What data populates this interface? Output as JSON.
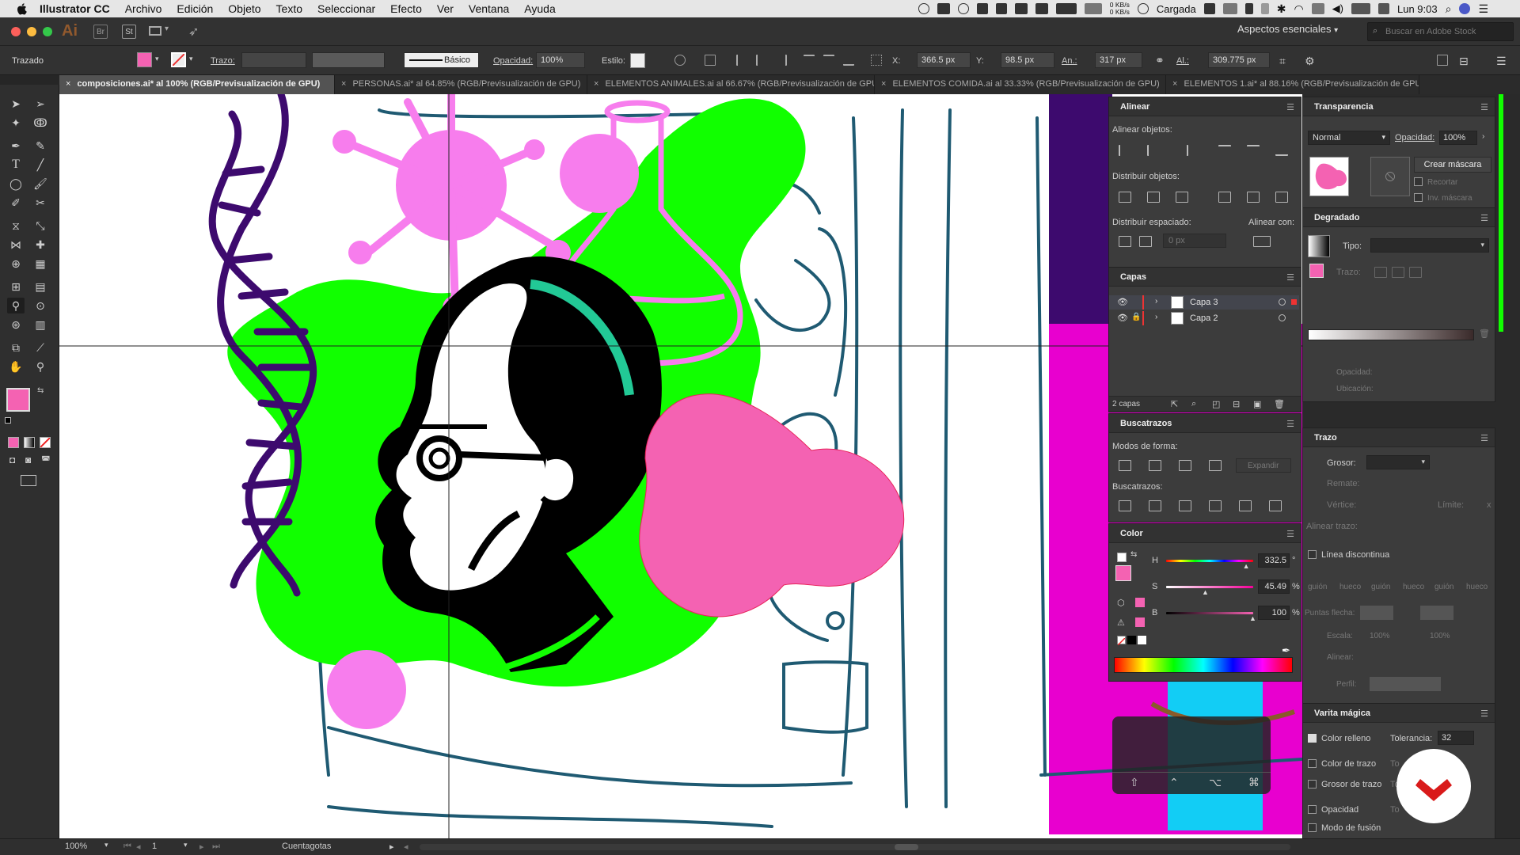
{
  "menubar": {
    "apple": "",
    "app": "Illustrator CC",
    "items": [
      "Archivo",
      "Edición",
      "Objeto",
      "Texto",
      "Seleccionar",
      "Efecto",
      "Ver",
      "Ventana",
      "Ayuda"
    ],
    "net_up": "0 KB/s",
    "net_down": "0 KB/s",
    "battery": "Cargada",
    "clock": "Lun 9:03"
  },
  "appbar": {
    "logo": "Ai",
    "br": "Br",
    "st": "St",
    "workspace": "Aspectos esenciales",
    "search_placeholder": "Buscar en Adobe Stock"
  },
  "control": {
    "selection": "Trazado",
    "stroke_label": "Trazo:",
    "brush": "Básico",
    "opacity_label": "Opacidad:",
    "opacity": "100%",
    "style_label": "Estilo:",
    "x_label": "X:",
    "x": "366.5 px",
    "y_label": "Y:",
    "y": "98.5 px",
    "w_label": "An.:",
    "w": "317 px",
    "h_label": "Al.:",
    "h": "309.775 px"
  },
  "tabs": [
    {
      "label": "composiciones.ai* al 100% (RGB/Previsualización de GPU)"
    },
    {
      "label": "PERSONAS.ai* al 64.85% (RGB/Previsualización de GPU)"
    },
    {
      "label": "ELEMENTOS ANIMALES.ai al 66.67% (RGB/Previsualización de GPU)"
    },
    {
      "label": "ELEMENTOS COMIDA.ai al 33.33% (RGB/Previsualización de GPU)"
    },
    {
      "label": "ELEMENTOS 1.ai* al 88.16% (RGB/Previsualización de GPU)"
    }
  ],
  "align": {
    "title": "Alinear",
    "align_objects": "Alinear objetos:",
    "distribute_objects": "Distribuir objetos:",
    "distribute_spacing": "Distribuir espaciado:",
    "align_to": "Alinear con:",
    "spacing": "0 px"
  },
  "layers": {
    "title": "Capas",
    "rows": [
      {
        "name": "Capa 3"
      },
      {
        "name": "Capa 2"
      }
    ],
    "count": "2 capas"
  },
  "pathfinder": {
    "title": "Buscatrazos",
    "shape_modes": "Modos de forma:",
    "expand": "Expandir",
    "pathfinders": "Buscatrazos:"
  },
  "color": {
    "title": "Color",
    "h_label": "H",
    "h": "332.5",
    "h_unit": "°",
    "s_label": "S",
    "s": "45.49",
    "s_unit": "%",
    "b_label": "B",
    "b": "100",
    "b_unit": "%",
    "fill_hex": "#f462b2",
    "h_fraction": 0.924,
    "s_fraction": 0.455,
    "b_fraction": 1.0
  },
  "transparency": {
    "title": "Transparencia",
    "blend": "Normal",
    "opacity_label": "Opacidad:",
    "opacity": "100%",
    "make_mask": "Crear máscara",
    "clip": "Recortar",
    "invert": "Inv. máscara"
  },
  "gradient": {
    "title": "Degradado",
    "type_label": "Tipo:",
    "stroke_label": "Trazo:",
    "opacity_label": "Opacidad:",
    "location_label": "Ubicación:"
  },
  "stroke": {
    "title": "Trazo",
    "weight_label": "Grosor:",
    "cap_label": "Remate:",
    "corner_label": "Vértice:",
    "limit_label": "Límite:",
    "limit_x": "x",
    "align_label": "Alinear trazo:",
    "dashed": "Línea discontinua",
    "dash_labels": [
      "guión",
      "hueco",
      "guión",
      "hueco",
      "guión",
      "hueco"
    ],
    "arrow_label": "Puntas flecha:",
    "scale_label": "Escala:",
    "scale1": "100%",
    "scale2": "100%",
    "align2_label": "Alinear:",
    "profile_label": "Perfil:"
  },
  "magicwand": {
    "title": "Varita mágica",
    "fill_color": "Color relleno",
    "tolerance_label": "Tolerancia:",
    "tolerance": "32",
    "stroke_color": "Color de trazo",
    "stroke_weight": "Grosor de trazo",
    "opacity": "Opacidad",
    "blend_mode": "Modo de fusión",
    "tol_short": "To"
  },
  "status": {
    "zoom": "100%",
    "artboard": "1",
    "tool": "Cuentagotas"
  },
  "colors": {
    "green": "#11ff00",
    "pink": "#f462b2",
    "lightpink": "#f77ded",
    "purple": "#3d0a6e",
    "magenta": "#e800cf",
    "cyan": "#12cdf5",
    "teal": "#22c996"
  }
}
